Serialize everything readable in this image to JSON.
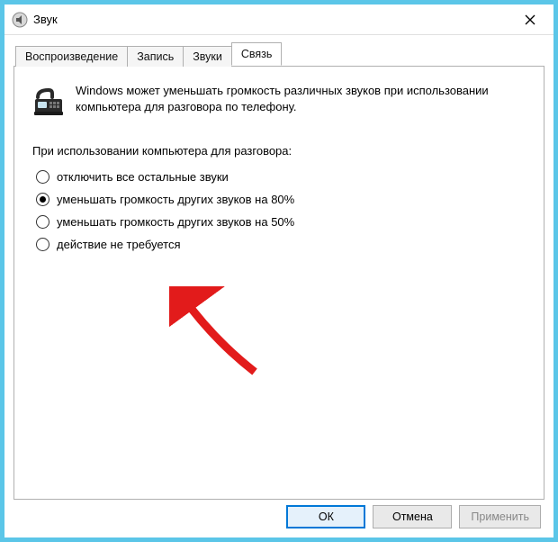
{
  "window": {
    "title": "Звук"
  },
  "tabs": {
    "t0": "Воспроизведение",
    "t1": "Запись",
    "t2": "Звуки",
    "t3": "Связь"
  },
  "panel": {
    "intro": "Windows может уменьшать громкость различных звуков при использовании компьютера для разговора по телефону.",
    "group_label": "При использовании компьютера для разговора:",
    "options": {
      "o0": "отключить все остальные звуки",
      "o1": "уменьшать громкость других звуков на 80%",
      "o2": "уменьшать громкость других звуков на 50%",
      "o3": "действие не требуется"
    },
    "selected_index": 1
  },
  "buttons": {
    "ok": "ОК",
    "cancel": "Отмена",
    "apply": "Применить"
  }
}
